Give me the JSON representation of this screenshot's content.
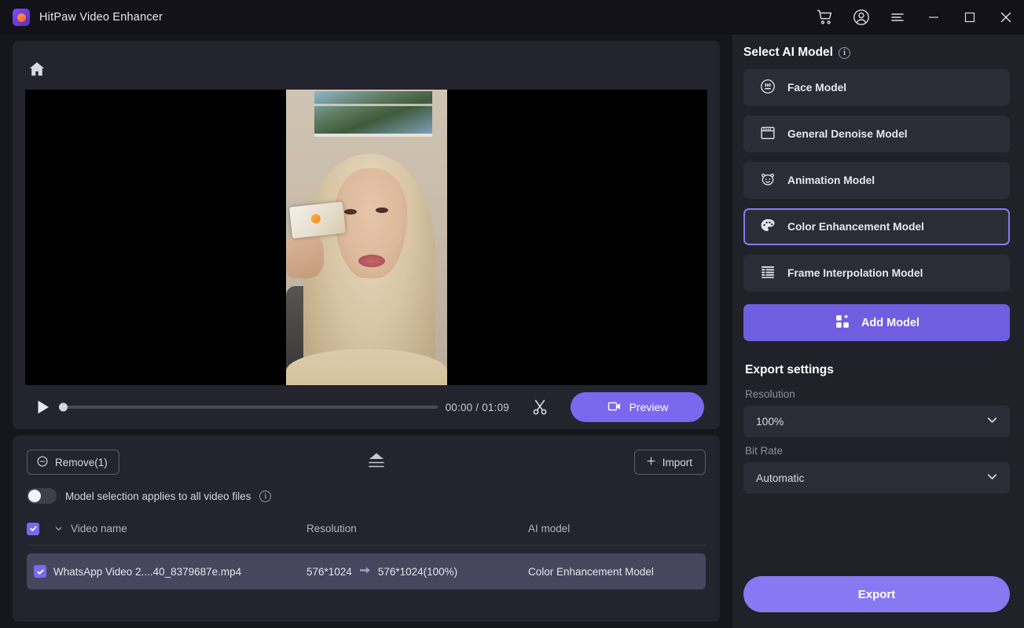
{
  "titlebar": {
    "app_title": "HitPaw Video Enhancer",
    "icons": [
      {
        "name": "cart-icon",
        "label": "Cart"
      },
      {
        "name": "account-icon",
        "label": "Account"
      },
      {
        "name": "menu-icon",
        "label": "Menu"
      },
      {
        "name": "minimize-icon",
        "label": "Minimize"
      },
      {
        "name": "maximize-icon",
        "label": "Maximize"
      },
      {
        "name": "close-icon",
        "label": "Close"
      }
    ]
  },
  "stage": {
    "home_icon": "home-icon"
  },
  "player": {
    "play_icon": "play-icon",
    "time": "00:00 / 01:09",
    "current_time": "00:00",
    "duration": "01:09",
    "progress_percent": 0,
    "cut_icon": "scissors-icon",
    "preview_label": "Preview",
    "preview_icon": "video-camera-icon"
  },
  "filepanel": {
    "remove_label": "Remove(1)",
    "remove_icon": "minus-circle-icon",
    "collapse_icon": "collapse-icon",
    "import_label": "Import",
    "import_icon": "plus-icon",
    "toggle_label": "Model selection applies to all video files",
    "toggle_on": false,
    "columns": [
      "Video name",
      "Resolution",
      "AI model"
    ],
    "rows": [
      {
        "checked": true,
        "video_name": "WhatsApp Video 2....40_8379687e.mp4",
        "resolution_in": "576*1024",
        "resolution_out": "576*1024(100%)",
        "ai_model": "Color Enhancement Model"
      }
    ]
  },
  "right_panel": {
    "title": "Select AI Model",
    "models": [
      {
        "label": "Face Model",
        "icon": "face-icon",
        "selected": false
      },
      {
        "label": "General Denoise Model",
        "icon": "calendar-icon",
        "selected": false
      },
      {
        "label": "Animation Model",
        "icon": "bear-icon",
        "selected": false
      },
      {
        "label": "Color Enhancement Model",
        "icon": "palette-icon",
        "selected": true
      },
      {
        "label": "Frame Interpolation Model",
        "icon": "list-icon",
        "selected": false
      }
    ],
    "add_model_label": "Add Model",
    "add_model_icon": "grid-plus-icon",
    "export_settings_title": "Export settings",
    "resolution_label": "Resolution",
    "resolution_value": "100%",
    "bitrate_label": "Bit Rate",
    "bitrate_value": "Automatic",
    "export_label": "Export"
  },
  "colors": {
    "accent": "#7b68ee",
    "accent_light": "#8878f2",
    "panel_bg": "#212129",
    "card_bg": "#2c2c37",
    "window_bg": "#16161d",
    "row_selected": "#46465f",
    "selected_border": "#8b78f5"
  }
}
